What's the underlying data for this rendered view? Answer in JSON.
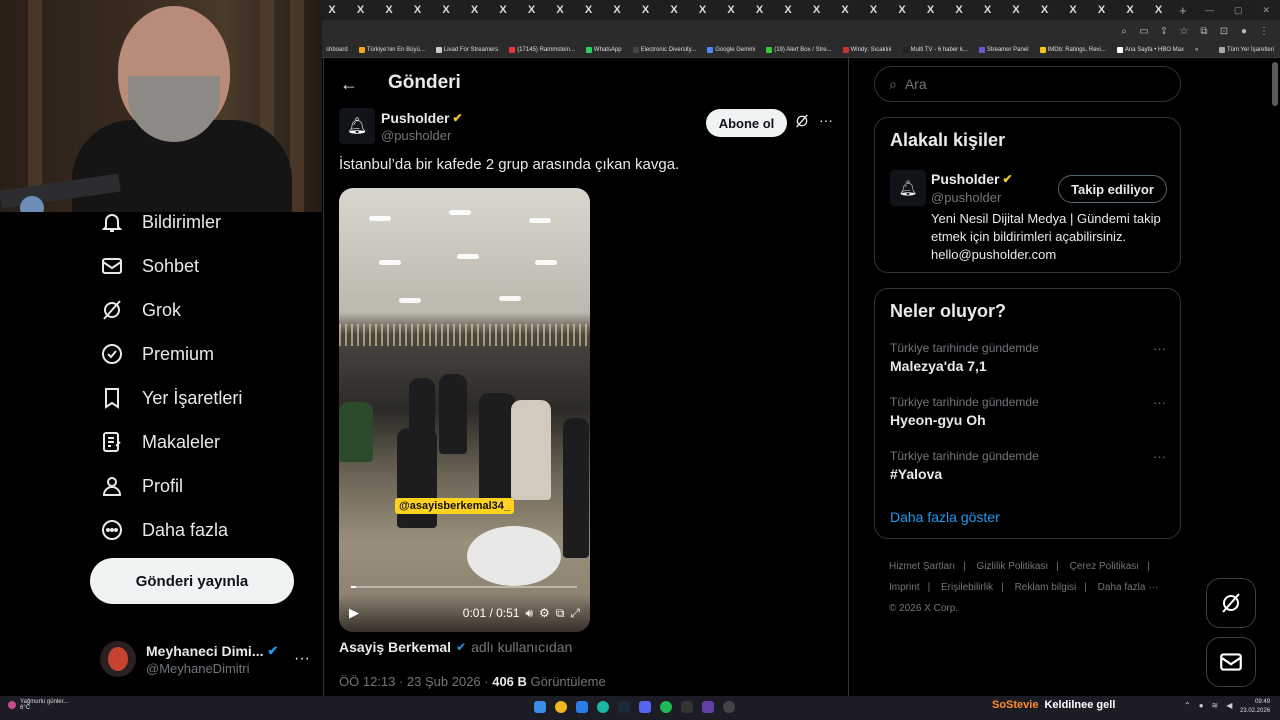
{
  "browser": {
    "tab_glyph": "X",
    "tab_new": "+",
    "bookmarks": [
      "shboard",
      "Türkiye'nin En Büyü...",
      "Livad For Streamers",
      "(17145) Rammstein...",
      "WhatsApp",
      "Electronic Diversity...",
      "Google Gemini",
      "(19) Alert Box / Stre...",
      "Windy: Sıcaklık",
      "Multi TV - 6 haber k...",
      "Streamer Panel",
      "IMDb: Ratings, Revi...",
      "Ana Sayfa • HBO Max"
    ],
    "bookmarks_overflow": "»",
    "bookmarks_all": "Tüm Yer İşaretleri"
  },
  "nav": {
    "items": [
      {
        "label": "Bildirimler",
        "icon": "bell-icon"
      },
      {
        "label": "Sohbet",
        "icon": "mail-icon"
      },
      {
        "label": "Grok",
        "icon": "grok-icon"
      },
      {
        "label": "Premium",
        "icon": "verified-icon"
      },
      {
        "label": "Yer İşaretleri",
        "icon": "bookmark-icon"
      },
      {
        "label": "Makaleler",
        "icon": "article-icon"
      },
      {
        "label": "Profil",
        "icon": "person-icon"
      },
      {
        "label": "Daha fazla",
        "icon": "more-circle-icon"
      }
    ],
    "post_button": "Gönderi yayınla",
    "account": {
      "name": "Meyhaneci Dimi...",
      "handle": "@MeyhaneDimitri",
      "more": "···"
    }
  },
  "post": {
    "header_title": "Gönderi",
    "author": {
      "name": "Pusholder",
      "handle": "@pusholder"
    },
    "subscribe_label": "Abone ol",
    "more": "···",
    "text": "İstanbul’da bir kafede 2 grup arasında çıkan kavga.",
    "video": {
      "watermark": "@asayisberkemal34_",
      "time": "0:01 / 0:51",
      "progress": 0.02
    },
    "credit": {
      "name": "Asayiş Berkemal",
      "suffix": "adlı kullanıcıdan"
    },
    "meta": {
      "time": "ÖÖ 12:13 · 23 Şub 2026 · ",
      "views": "406 B",
      "views_label": " Görüntüleme"
    }
  },
  "right": {
    "search_placeholder": "Ara",
    "related": {
      "title": "Alakalı kişiler",
      "name": "Pusholder",
      "handle": "@pusholder",
      "follow_label": "Takip ediliyor",
      "bio": "Yeni Nesil Dijital Medya | Gündemi takip etmek için bildirimleri açabilirsiniz. hello@pusholder.com"
    },
    "trends": {
      "title": "Neler oluyor?",
      "items": [
        {
          "category": "Türkiye tarihinde gündemde",
          "topic": "Malezya'da 7,1"
        },
        {
          "category": "Türkiye tarihinde gündemde",
          "topic": "Hyeon-gyu Oh"
        },
        {
          "category": "Türkiye tarihinde gündemde",
          "topic": "#Yalova"
        }
      ],
      "more": "···",
      "show_more": "Daha fazla göster"
    },
    "footer": {
      "links": [
        "Hizmet Şartları",
        "|",
        "Gizlilik Politikası",
        "|",
        "Çerez Politikası",
        "|",
        "Imprint",
        "|",
        "Erişilebilirlik",
        "|",
        "Reklam bilgisi",
        "|",
        "Daha fazla ···"
      ],
      "copyright": "© 2026 X Corp."
    }
  },
  "taskbar": {
    "weather": "Yağmurlu günler...",
    "temp": "6°C",
    "overlay_user": "SoStevie",
    "overlay_msg": "Keldilnee gell",
    "time": "09:49",
    "date": "23.02.2026"
  },
  "colors": {
    "accent": "#1d9bf0",
    "verified": "#f4c430",
    "verified_blue": "#1d9bf0",
    "bg": "#000000"
  }
}
